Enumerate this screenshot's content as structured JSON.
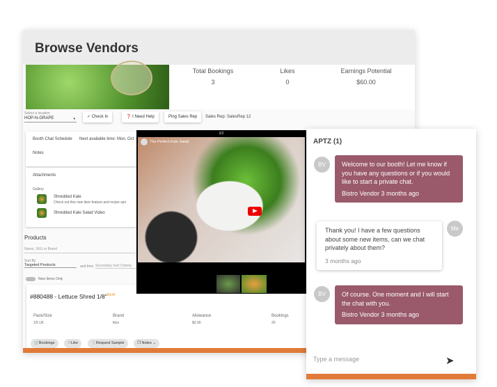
{
  "header": {
    "title": "Browse Vendors"
  },
  "stats": [
    {
      "label": "Total Bookings",
      "value": "3"
    },
    {
      "label": "Likes",
      "value": "0"
    },
    {
      "label": "Earnings Potential",
      "value": "$60.00"
    }
  ],
  "toolbar": {
    "location_label": "Select a location",
    "location_value": "HOP-N-GRAPE",
    "check_in": "Check In",
    "need_help": "I Need Help",
    "ping": "Ping Sales Rep",
    "sales_rep": "Sales Rep: SalesRep 12"
  },
  "booth": {
    "schedule": "Booth Chat Schedule",
    "next": "Next available time: Mon, Oct",
    "notes": "Notes"
  },
  "attachments": {
    "title": "Attachments",
    "gallery": "Gallery",
    "items": [
      {
        "title": "Shredded Kale",
        "desc": "Check out this new item feature and recipe spo"
      },
      {
        "title": "Shredded Kale Salad Video"
      }
    ]
  },
  "products": {
    "title": "Products",
    "search_placeholder": "Name, SKU or Brand",
    "sort_label": "Sort By",
    "sort_value": "Targeted Products",
    "and_then": "and then",
    "secondary_placeholder": "Secondary Sort Criteria",
    "new_only": "New Items Only",
    "item": {
      "title": "#880488 - Lettuce Shred 1/8\"",
      "badge": "NEW",
      "fields": [
        {
          "label": "Pack/Size",
          "value": "1/5 LB"
        },
        {
          "label": "Brand",
          "value": "lttce"
        },
        {
          "label": "Allowance",
          "value": "$2.00"
        },
        {
          "label": "Bookings",
          "value": "20"
        }
      ],
      "actions": [
        "Bookings",
        "Like",
        "Request Sample",
        "Notes"
      ]
    }
  },
  "video": {
    "title": "The Perfect Kale Salad",
    "counter": "2/2"
  },
  "chat": {
    "title": "APTZ (1)",
    "messages": [
      {
        "from": "BV",
        "text": "Welcome to our booth! Let me know if you have any questions or if you would like to start a private chat.",
        "meta": "Bistro Vendor  3 months ago"
      },
      {
        "from": "Me",
        "text": "Thank you! I have a few questions about some new items, can we chat privately about them?",
        "meta": "3 months ago"
      },
      {
        "from": "BV",
        "text": "Of course. One moment and I will start the chat with you.",
        "meta": "Bistro Vendor  3 months ago"
      }
    ],
    "input_placeholder": "Type a message"
  },
  "colors": {
    "accent": "#e07b39",
    "bubble": "#9a5a6c"
  }
}
